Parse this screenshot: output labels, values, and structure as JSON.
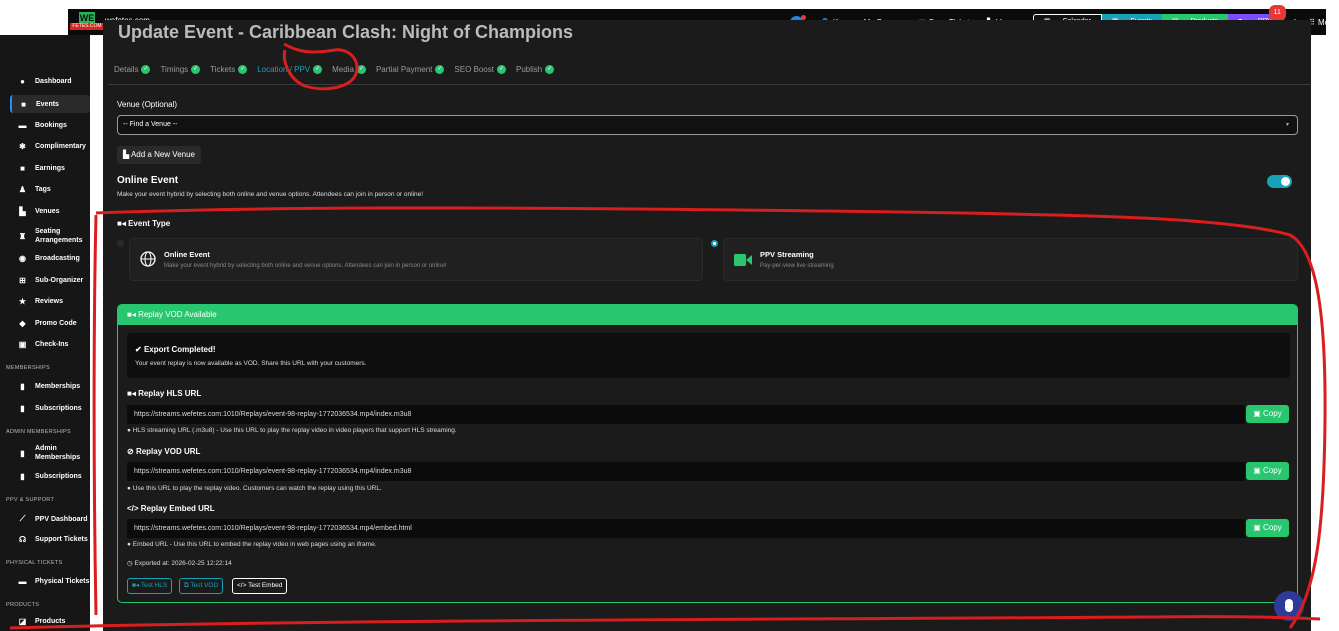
{
  "topbar": {
    "logo_text": "WE",
    "logo_sub": "FETES.COM",
    "site_url": "wefetes.com",
    "user_name": "Kenwyn Mc Sween",
    "scan_ticket": "Scan Ticket",
    "venues": "Venues",
    "calendar": "Calendar",
    "events": "Events",
    "products": "Products",
    "ppv": "PPV",
    "ppv_badge": "11",
    "more": "More"
  },
  "sidebar": {
    "items": [
      {
        "label": "Dashboard",
        "icon": "info-icon"
      },
      {
        "label": "Events",
        "icon": "calendar-icon"
      },
      {
        "label": "Bookings",
        "icon": "ticket-icon"
      },
      {
        "label": "Complimentary",
        "icon": "gift-icon"
      },
      {
        "label": "Earnings",
        "icon": "wallet-icon"
      },
      {
        "label": "Tags",
        "icon": "users-icon"
      },
      {
        "label": "Venues",
        "icon": "building-icon"
      },
      {
        "label": "Seating Arrangements",
        "icon": "chair-icon"
      },
      {
        "label": "Broadcasting",
        "icon": "broadcast-icon"
      },
      {
        "label": "Sub-Organizer",
        "icon": "sitemap-icon"
      },
      {
        "label": "Reviews",
        "icon": "star-icon"
      },
      {
        "label": "Promo Code",
        "icon": "tag-icon"
      },
      {
        "label": "Check-Ins",
        "icon": "checkin-icon"
      },
      {
        "label": "Memberships",
        "icon": "id-card-icon"
      },
      {
        "label": "Subscriptions",
        "icon": "id-card-icon"
      },
      {
        "label": "Admin Memberships",
        "icon": "id-card-icon"
      },
      {
        "label": "Subscriptions",
        "icon": "id-card-icon"
      },
      {
        "label": "PPV Dashboard",
        "icon": "chart-icon"
      },
      {
        "label": "Support Tickets",
        "icon": "headset-icon"
      },
      {
        "label": "Physical Tickets",
        "icon": "ticket-icon"
      },
      {
        "label": "Products",
        "icon": "box-icon"
      }
    ],
    "sections": {
      "memberships": "MEMBERSHIPS",
      "admin_memberships": "ADMIN MEMBERSHIPS",
      "ppv_support": "PPV & SUPPORT",
      "physical_tickets": "PHYSICAL TICKETS",
      "products": "PRODUCTS"
    }
  },
  "page": {
    "title": "Update Event - Caribbean Clash: Night of Champions",
    "tabs": [
      "Details",
      "Timings",
      "Tickets",
      "Location / PPV",
      "Media",
      "Partial Payment",
      "SEO Boost",
      "Publish"
    ],
    "active_tab": "Location / PPV"
  },
  "venue": {
    "label": "Venue (Optional)",
    "select_value": "-- Find a Venue --",
    "add_button": "Add a New Venue"
  },
  "online": {
    "title": "Online Event",
    "description": "Make your event hybrid by selecting both online and venue options. Attendees can join in person or online!",
    "toggle_on": true
  },
  "event_type": {
    "label": "Event Type",
    "online_title": "Online Event",
    "online_desc": "Make your event hybrid by selecting both online and venue options. Attendees can join in person or online!",
    "ppv_title": "PPV Streaming",
    "ppv_desc": "Pay-per-view live streaming"
  },
  "replay": {
    "header": "Replay VOD Available",
    "export_title": "Export Completed!",
    "export_desc": "Your event replay is now available as VOD. Share this URL with your customers.",
    "hls_title": "Replay HLS URL",
    "hls_url": "https://streams.wefetes.com:1010/Replays/event-98-replay-1772036534.mp4/index.m3u8",
    "hls_hint": "HLS streaming URL (.m3u8) - Use this URL to play the replay video in video players that support HLS streaming.",
    "vod_title": "Replay VOD URL",
    "vod_url": "https://streams.wefetes.com:1010/Replays/event-98-replay-1772036534.mp4/index.m3u8",
    "vod_hint": "Use this URL to play the replay video. Customers can watch the replay using this URL.",
    "embed_title": "Replay Embed URL",
    "embed_url": "https://streams.wefetes.com:1010/Replays/event-98-replay-1772036534.mp4/embed.html",
    "embed_hint": "Embed URL - Use this URL to embed the replay video in web pages using an iframe.",
    "exported_at": "Exported at: 2026-02-25 12:22:14",
    "copy_label": "Copy",
    "test_hls": "Test HLS",
    "test_vod": "Test VOD",
    "test_embed": "Test Embed"
  },
  "colors": {
    "accent_teal": "#17a2b8",
    "success_green": "#28c76f",
    "annotation_red": "#d81e1e"
  }
}
